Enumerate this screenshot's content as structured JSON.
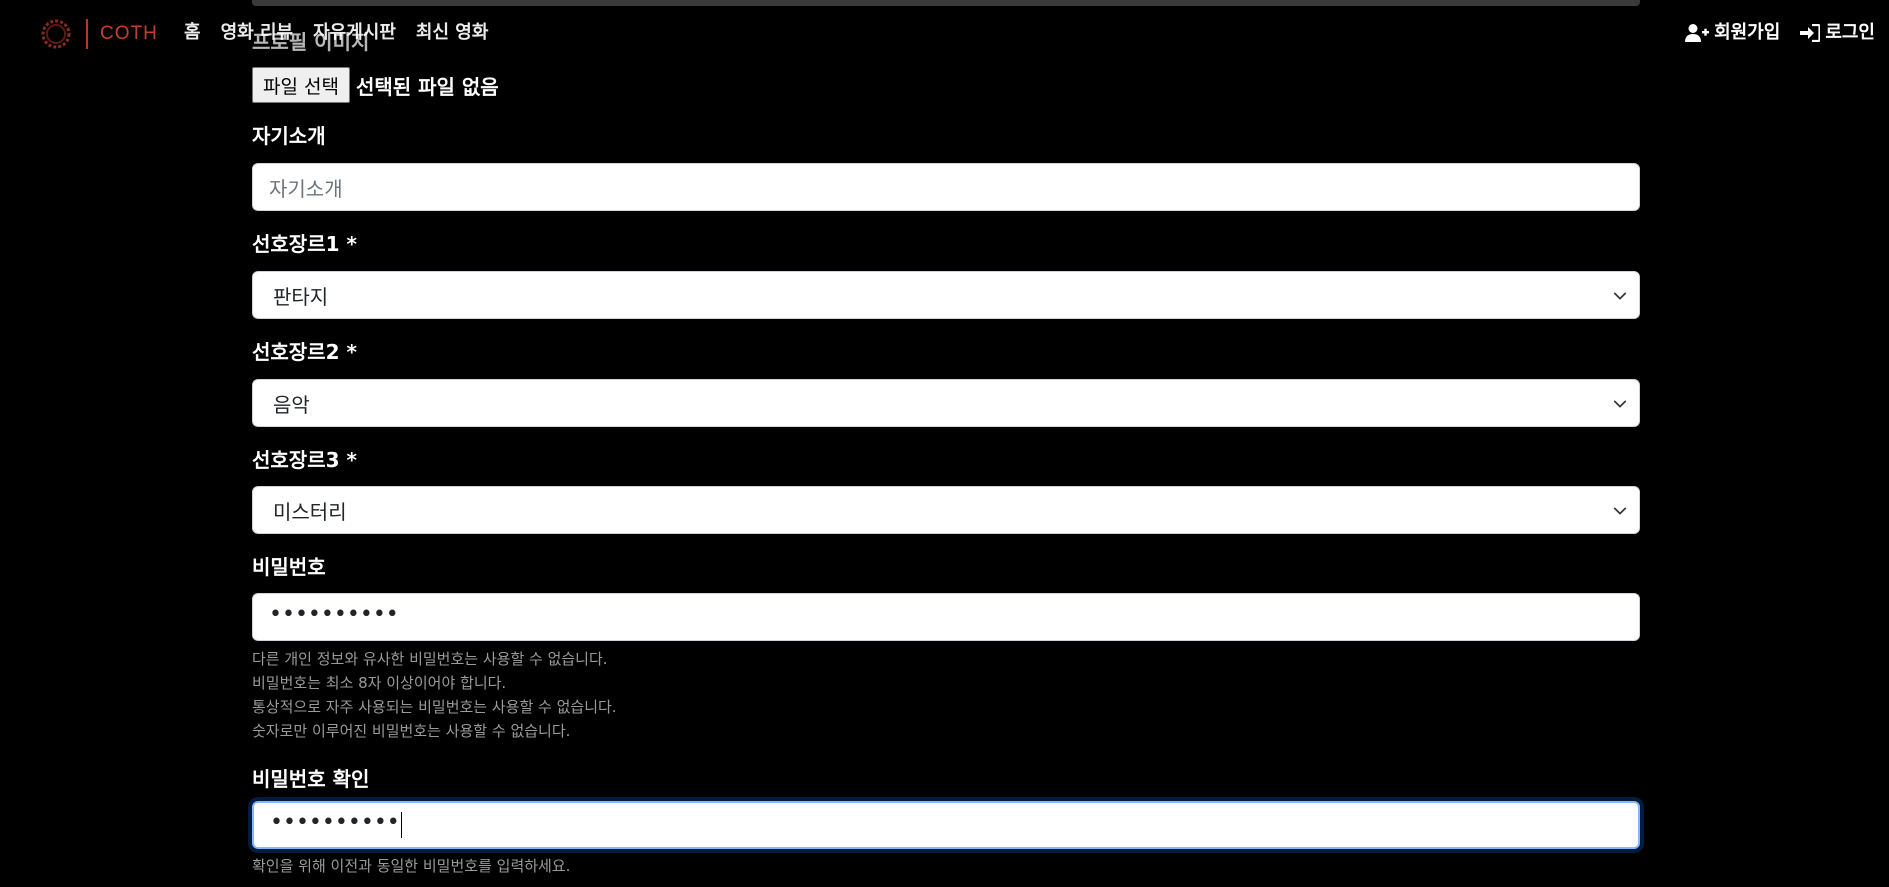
{
  "nav": {
    "brand_text": "COTH",
    "links": [
      "홈",
      "영화 리뷰",
      "자유게시판",
      "최신 영화"
    ],
    "signup": "회원가입",
    "login": "로그인"
  },
  "form": {
    "profile_image_label": "프로필 이미지",
    "file_button": "파일 선택",
    "file_status": "선택된 파일 없음",
    "bio_label": "자기소개",
    "bio_placeholder": "자기소개",
    "genre1_label": "선호장르1 *",
    "genre1_value": "판타지",
    "genre2_label": "선호장르2 *",
    "genre2_value": "음악",
    "genre3_label": "선호장르3 *",
    "genre3_value": "미스터리",
    "password_label": "비밀번호",
    "password_mask": "••••••••••",
    "password_help": [
      "다른 개인 정보와 유사한 비밀번호는 사용할 수 없습니다.",
      "비밀번호는 최소 8자 이상이어야 합니다.",
      "통상적으로 자주 사용되는 비밀번호는 사용할 수 없습니다.",
      "숫자로만 이루어진 비밀번호는 사용할 수 없습니다."
    ],
    "password_confirm_label": "비밀번호 확인",
    "password_confirm_mask": "••••••••••",
    "password_confirm_help": "확인을 위해 이전과 동일한 비밀번호를 입력하세요."
  },
  "colors": {
    "background": "#000000",
    "brand_red": "#c2402c",
    "help_text": "#9a9a9a",
    "focus_ring": "#86b7fe"
  },
  "icons": {
    "signup": "user-plus-icon",
    "login": "sign-in-icon",
    "select": "chevron-down-icon",
    "logo": "film-reel-logo"
  }
}
